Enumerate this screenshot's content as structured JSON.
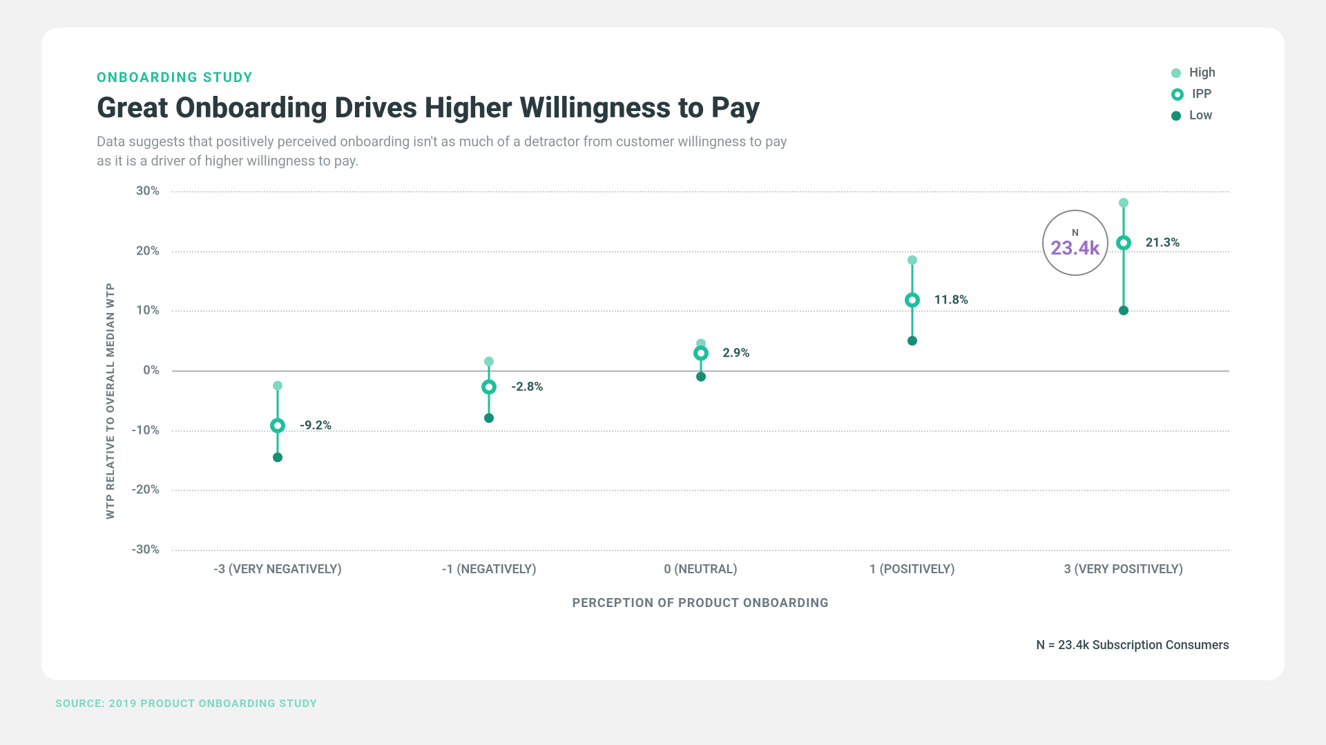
{
  "eyebrow": "ONBOARDING STUDY",
  "title": "Great Onboarding Drives Higher Willingness to Pay",
  "subtitle": "Data suggests that positively perceived onboarding isn't as much of a detractor from customer willingness to pay as it is a driver of higher willingness to pay.",
  "legend": {
    "high": "High",
    "ipp": "IPP",
    "low": "Low"
  },
  "xlabel": "PERCEPTION OF PRODUCT ONBOARDING",
  "ylabel": "WTP RELATIVE TO OVERALL MEDIAN WTP",
  "footnote": "N = 23.4k Subscription Consumers",
  "source": "SOURCE: 2019 PRODUCT ONBOARDING STUDY",
  "n_badge": {
    "label": "N",
    "value": "23.4k"
  },
  "yticks": [
    "30%",
    "20%",
    "10%",
    "0%",
    "-10%",
    "-20%",
    "-30%"
  ],
  "categories": [
    "-3 (VERY NEGATIVELY)",
    "-1 (NEGATIVELY)",
    "0 (NEUTRAL)",
    "1 (POSITIVELY)",
    "3 (VERY POSITIVELY)"
  ],
  "ipp_labels": [
    "-9.2%",
    "-2.8%",
    "2.9%",
    "11.8%",
    "21.3%"
  ],
  "chart_data": {
    "type": "scatter",
    "title": "Great Onboarding Drives Higher Willingness to Pay",
    "xlabel": "PERCEPTION OF PRODUCT ONBOARDING",
    "ylabel": "WTP RELATIVE TO OVERALL MEDIAN WTP",
    "ylim": [
      -30,
      30
    ],
    "categories": [
      "-3 (VERY NEGATIVELY)",
      "-1 (NEGATIVELY)",
      "0 (NEUTRAL)",
      "1 (POSITIVELY)",
      "3 (VERY POSITIVELY)"
    ],
    "series": [
      {
        "name": "High",
        "values": [
          -2.5,
          1.5,
          4.5,
          18.5,
          28.0
        ]
      },
      {
        "name": "IPP",
        "values": [
          -9.2,
          -2.8,
          2.9,
          11.8,
          21.3
        ]
      },
      {
        "name": "Low",
        "values": [
          -14.5,
          -8.0,
          -1.0,
          5.0,
          10.0
        ]
      }
    ],
    "n": "23.4k"
  }
}
